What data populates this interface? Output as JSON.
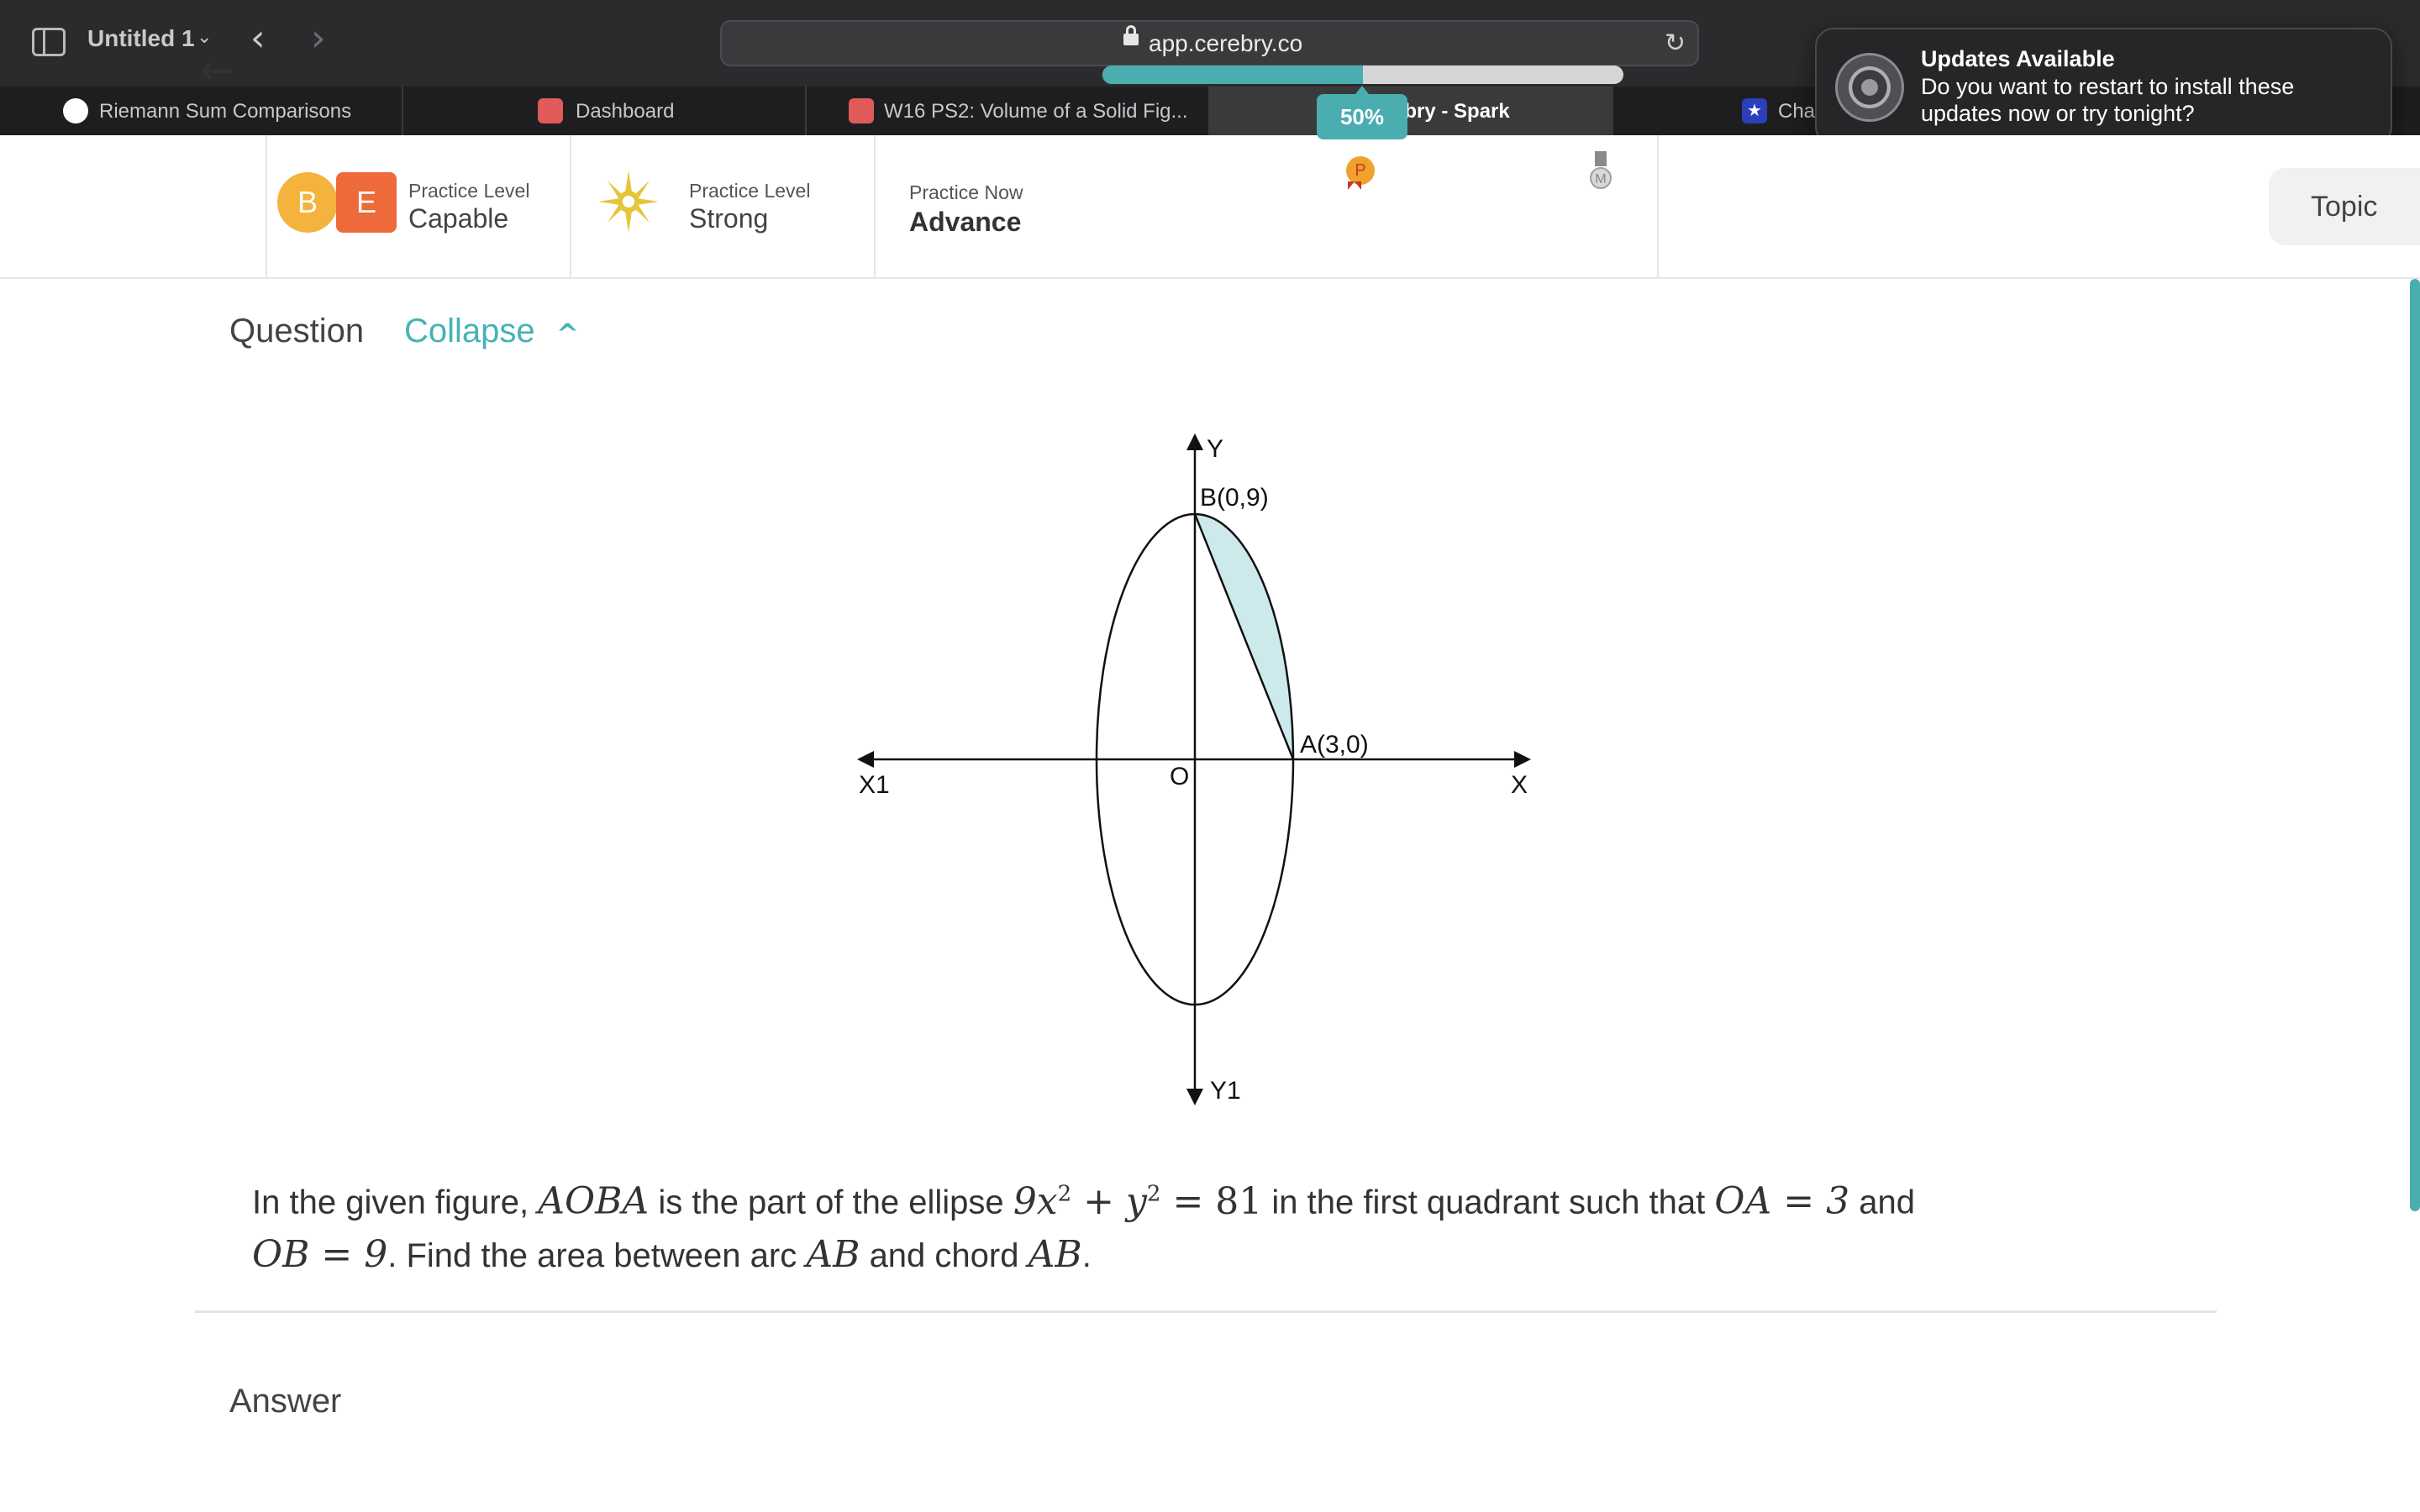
{
  "browser": {
    "window_title": "Untitled 1",
    "url": "app.cerebry.co",
    "tabs": [
      {
        "label": "Riemann Sum Comparisons",
        "icon": "openai-icon",
        "active": false
      },
      {
        "label": "Dashboard",
        "icon": "cerebry-red-icon",
        "active": false
      },
      {
        "label": "W16 PS2: Volume of a Solid Fig...",
        "icon": "cerebry-red-icon",
        "active": false
      },
      {
        "label": "Cerebry - Spark",
        "icon": "cerebry-c-icon",
        "active": true
      },
      {
        "label": "Cha",
        "icon": "star-icon",
        "active": false
      }
    ]
  },
  "notification": {
    "title": "Updates Available",
    "body": "Do you want to restart to install these updates now or try tonight?",
    "icon": "system-preferences-icon"
  },
  "header": {
    "level1": {
      "badge_b": "B",
      "badge_e": "E",
      "caption": "Practice Level",
      "value": "Capable"
    },
    "level2": {
      "caption": "Practice Level",
      "value": "Strong"
    },
    "level3": {
      "caption": "Practice Now",
      "value": "Advance"
    },
    "progress": {
      "percent_label": "50%",
      "fraction": 0.5,
      "medal_p": "P",
      "medal_m": "M"
    },
    "topic_button": "Topic"
  },
  "question": {
    "label": "Question",
    "collapse_label": "Collapse",
    "figure": {
      "axis_y": "Y",
      "axis_y1": "Y1",
      "axis_x": "X",
      "axis_x1": "X1",
      "origin": "O",
      "point_b": "B(0,9)",
      "point_a": "A(3,0)"
    },
    "text": {
      "part1": "In the given figure,",
      "m_aoba": "AOBA",
      "part2": "is the part of the ellipse",
      "m_eq_a": "9x",
      "m_eq_b": "+ y",
      "m_eq_c": "= 81",
      "sup": "2",
      "part3": "in the first quadrant such that",
      "m_oa": "OA = 3",
      "part4": "and",
      "m_ob": "OB = 9",
      "part5": ". Find the area between arc",
      "m_ab1": "AB",
      "part6": "and chord",
      "m_ab2": "AB",
      "part7": "."
    }
  },
  "answer": {
    "label": "Answer"
  },
  "colors": {
    "accent": "#4aadb0",
    "shaded_region": "#cde9ec",
    "chrome": "#2b2b2d"
  }
}
